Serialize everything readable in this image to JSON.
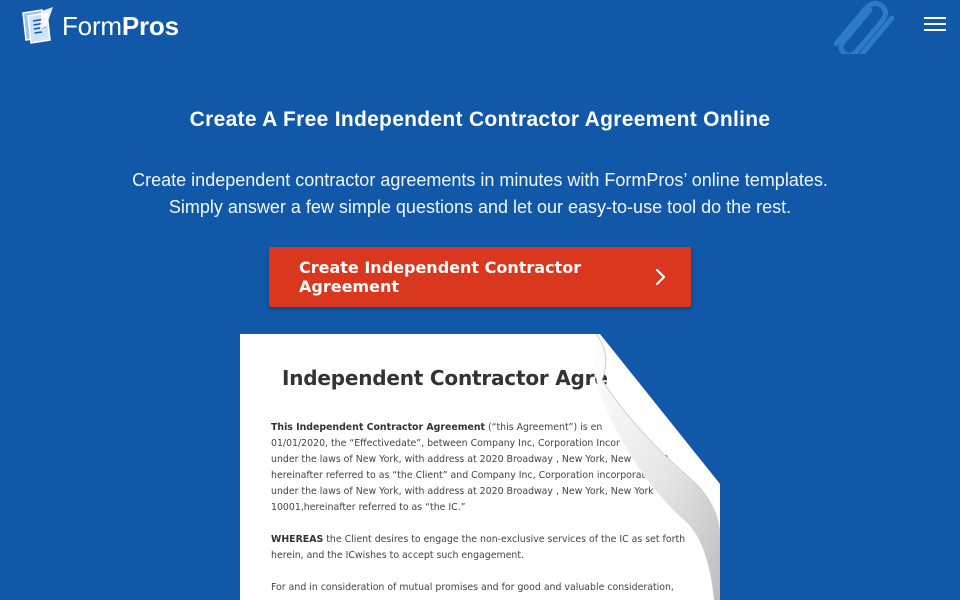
{
  "header": {
    "logo_light": "Form",
    "logo_bold": "Pros",
    "logo_icon": "form-document-icon",
    "menu_icon": "hamburger-icon"
  },
  "hero": {
    "title": "Create A Free Independent Contractor Agreement Online",
    "subtitle": "Create independent contractor agreements in minutes with  FormPros’ online templates. Simply answer a few simple questions and let our easy-to-use tool do the rest.",
    "cta_label": "Create Independent Contractor Agreement",
    "cta_icon": "chevron-right-icon"
  },
  "document": {
    "title": "Independent Contractor Agre",
    "para1": [
      {
        "bold": "This Independent Contractor Agreement",
        "text": " (“this Agreement”) is en"
      },
      {
        "bold": "",
        "text": "01/01/2020, the “Effectivedate”, between Company Inc, Corporation Incor"
      },
      {
        "bold": "",
        "text": "under the laws of New York, with address at 2020 Broadway , New York, New York 10"
      },
      {
        "bold": "",
        "text": "hereinafter referred to as “the Client” and Company Inc, Corporation incorporated"
      },
      {
        "bold": "",
        "text": "under the laws of New York, with address at 2020 Broadway , New York, New York"
      },
      {
        "bold": "",
        "text": "10001,hereinafter referred to as “the IC.”"
      }
    ],
    "para2": [
      {
        "bold": "WHEREAS",
        "text": " the Client desires to engage the non-exclusive services of the IC as set forth"
      },
      {
        "bold": "",
        "text": "herein, and the ICwishes to accept such engagement."
      }
    ],
    "para3": [
      {
        "bold": "",
        "text": "For and in consideration of mutual promises and for good and valuable consideration,"
      }
    ]
  },
  "colors": {
    "background": "#1158a8",
    "cta": "#d9381e",
    "text": "#ffffff"
  }
}
